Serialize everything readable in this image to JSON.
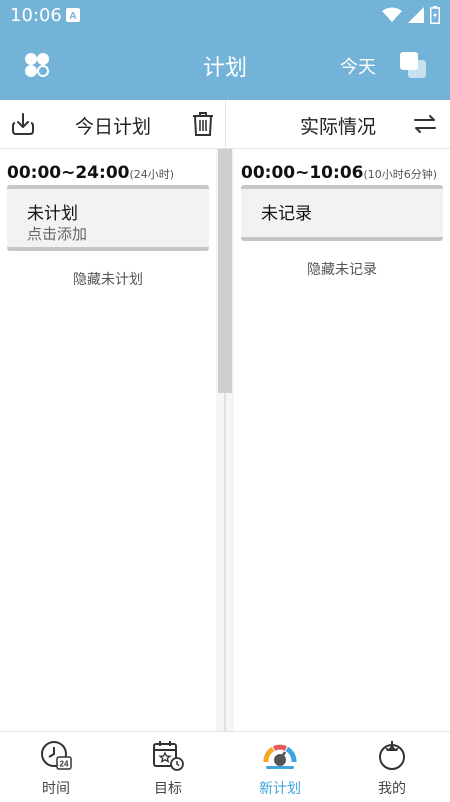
{
  "status_bar": {
    "time": "10:06",
    "notification_icon": "a-icon",
    "icons": [
      "wifi-icon",
      "signal-icon",
      "battery-icon"
    ]
  },
  "app_bar": {
    "title": "计划",
    "today_label": "今天",
    "menu_icon": "clover-icon",
    "copy_icon": "copy-icon",
    "color": "#74b3d8"
  },
  "toolbar": {
    "left_title": "今日计划",
    "right_title": "实际情况",
    "icons": [
      "download-icon",
      "trash-icon",
      "swap-icon"
    ]
  },
  "plan": {
    "range": "00:00~24:00",
    "duration": "(24小时)",
    "card_title": "未计划",
    "card_subtitle": "点击添加",
    "hide_link": "隐藏未计划"
  },
  "actual": {
    "range": "00:00~10:06",
    "duration": "(10小时6分钟)",
    "card_title": "未记录",
    "hide_link": "隐藏未记录"
  },
  "bottom_nav": {
    "active": "新计划",
    "active_color": "#3ea4dd",
    "items": [
      {
        "label": "时间",
        "icon": "clock-24-icon"
      },
      {
        "label": "目标",
        "icon": "calendar-goal-icon"
      },
      {
        "label": "新计划",
        "icon": "new-plan-icon"
      },
      {
        "label": "我的",
        "icon": "tomato-icon"
      }
    ]
  }
}
